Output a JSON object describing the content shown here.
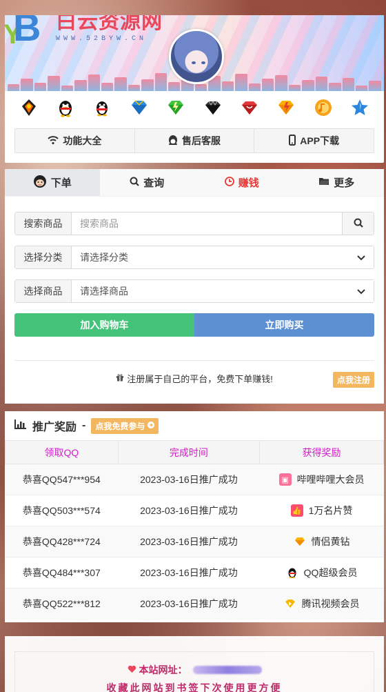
{
  "header": {
    "logo_title": "白云资源网",
    "logo_url": "WWW.52BYW.CN",
    "icons": [
      "qq-flame-icon",
      "qq-penguin-icon",
      "qq-penguin-red-icon",
      "blue-diamond-icon",
      "green-diamond-icon",
      "black-diamond-icon",
      "red-diamond-icon",
      "yellow-diamond-icon",
      "music-icon",
      "star-icon"
    ],
    "nav": [
      {
        "icon": "wifi-icon",
        "label": "功能大全"
      },
      {
        "icon": "service-icon",
        "label": "售后客服"
      },
      {
        "icon": "mobile-icon",
        "label": "APP下载"
      }
    ]
  },
  "order": {
    "tabs": [
      {
        "label": "下单",
        "icon": "user-avatar-icon"
      },
      {
        "label": "查询",
        "icon": "search-icon"
      },
      {
        "label": "赚钱",
        "icon": "money-icon"
      },
      {
        "label": "更多",
        "icon": "folder-icon"
      }
    ],
    "search_label": "搜索商品",
    "search_placeholder": "搜索商品",
    "category_label": "选择分类",
    "category_value": "请选择分类",
    "product_label": "选择商品",
    "product_value": "请选择商品",
    "cart_label": "加入购物车",
    "buy_label": "立即购买",
    "register_text": "注册属于自己的平台，免费下单赚钱!",
    "register_button": "点我注册"
  },
  "promo": {
    "title": "推广奖励",
    "dash": "-",
    "join_label": "点我免费参与",
    "columns": [
      "领取QQ",
      "完成时间",
      "获得奖励"
    ],
    "rows": [
      {
        "qq": "恭喜QQ547***954",
        "time": "2023-03-16日推广成功",
        "reward": "哔哩哔哩大会员",
        "icon": "bilibili-icon",
        "color": "#fb7299"
      },
      {
        "qq": "恭喜QQ503***574",
        "time": "2023-03-16日推广成功",
        "reward": "1万名片赞",
        "icon": "thumbs-up-icon",
        "color": "#ff4d6d"
      },
      {
        "qq": "恭喜QQ428***724",
        "time": "2023-03-16日推广成功",
        "reward": "情侣黄钻",
        "icon": "yellow-diamond-icon",
        "color": "#f7b500"
      },
      {
        "qq": "恭喜QQ484***307",
        "time": "2023-03-16日推广成功",
        "reward": "QQ超级会员",
        "icon": "qq-penguin-icon",
        "color": "#222222"
      },
      {
        "qq": "恭喜QQ522***812",
        "time": "2023-03-16日推广成功",
        "reward": "腾讯视频会员",
        "icon": "tencent-video-icon",
        "color": "#f7b500"
      }
    ]
  },
  "footer": {
    "site_label": "本站网址：",
    "bookmark": "收藏此网站到书签下次使用更方便"
  },
  "colors": {
    "accent_green": "#46c37b",
    "accent_blue": "#5c90d2",
    "warning": "#f3b760",
    "header_purple": "#d01fc6",
    "footer_pink": "#c0286a"
  }
}
